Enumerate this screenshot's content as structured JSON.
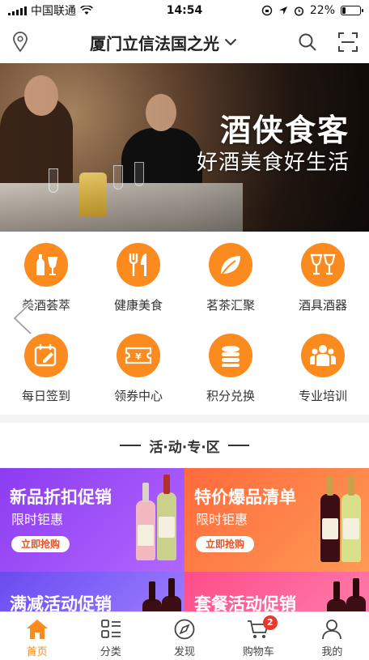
{
  "status_bar": {
    "carrier": "中国联通",
    "time": "14:54",
    "battery": "22%",
    "battery_level": 0.22
  },
  "nav": {
    "title": "厦门立信法国之光",
    "icons": [
      "location-pin-icon",
      "chevron-down-icon",
      "search-icon",
      "scan-icon"
    ]
  },
  "banner": {
    "title": "酒侠食客",
    "subtitle": "好酒美食好生活"
  },
  "categories": [
    {
      "label": "美酒荟萃",
      "icon": "wine-bottle-icon"
    },
    {
      "label": "健康美食",
      "icon": "fork-knife-icon"
    },
    {
      "label": "茗茶汇聚",
      "icon": "tea-leaf-icon"
    },
    {
      "label": "酒具酒器",
      "icon": "wine-glass-icon"
    },
    {
      "label": "每日签到",
      "icon": "calendar-pen-icon"
    },
    {
      "label": "领券中心",
      "icon": "coupon-icon"
    },
    {
      "label": "积分兑换",
      "icon": "coins-stack-icon"
    },
    {
      "label": "专业培训",
      "icon": "people-icon"
    }
  ],
  "activity": {
    "header": "活·动·专·区",
    "cards": [
      {
        "title": "新品折扣促销",
        "subtitle": "限时钜惠",
        "button": "立即抢购",
        "color_from": "#8c3cf0",
        "color_to": "#b266ff"
      },
      {
        "title": "特价爆品清单",
        "subtitle": "限时钜惠",
        "button": "立即抢购",
        "color_from": "#ff6a3c",
        "color_to": "#ff9a55"
      },
      {
        "title": "满减活动促销",
        "subtitle": "",
        "button": "",
        "color_from": "#6a4cf0",
        "color_to": "#9a7bff"
      },
      {
        "title": "套餐活动促销",
        "subtitle": "",
        "button": "",
        "color_from": "#ff4d8a",
        "color_to": "#ff7aa8"
      }
    ]
  },
  "tabbar": {
    "items": [
      {
        "label": "首页",
        "icon": "home-icon",
        "active": true
      },
      {
        "label": "分类",
        "icon": "category-list-icon",
        "active": false
      },
      {
        "label": "发现",
        "icon": "compass-icon",
        "active": false
      },
      {
        "label": "购物车",
        "icon": "cart-icon",
        "active": false,
        "badge": "2"
      },
      {
        "label": "我的",
        "icon": "user-icon",
        "active": false
      }
    ]
  },
  "colors": {
    "accent": "#fb8b1f",
    "badge": "#e8372c"
  }
}
